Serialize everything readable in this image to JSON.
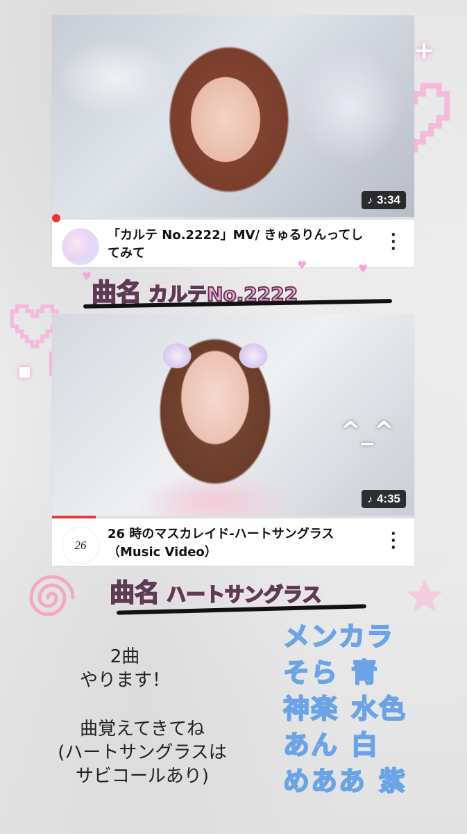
{
  "cards": [
    {
      "duration": "3:34",
      "title": "「カルテ No.2222」MV/ きゅるりんってしてみて",
      "channel_avatar_text": "",
      "progress": 0.0
    },
    {
      "duration": "4:35",
      "title": "26 時のマスカレイド-ハートサングラス（Music Video）",
      "channel_avatar_text": "26",
      "progress": 0.12
    }
  ],
  "song_labels": [
    {
      "prefix": "曲名",
      "name": "カルテNo.2222"
    },
    {
      "prefix": "曲名",
      "name": "ハートサングラス"
    }
  ],
  "left_text": {
    "songs_count": "2曲\nやります！",
    "note": "曲覚えてきてね\n(ハートサングラスは\nサビコールあり)"
  },
  "member_colors": {
    "header": "メンカラ",
    "rows": [
      {
        "name": "そら",
        "color": "青"
      },
      {
        "name": "神楽",
        "color": "水色"
      },
      {
        "name": "あん",
        "color": "白"
      },
      {
        "name": "めああ",
        "color": "紫"
      }
    ]
  },
  "colors": {
    "pink_accent": "#f3a9d6",
    "blue_text": "#6aa3e6",
    "progress_red": "#e53935"
  },
  "decoration_text": "^_^"
}
